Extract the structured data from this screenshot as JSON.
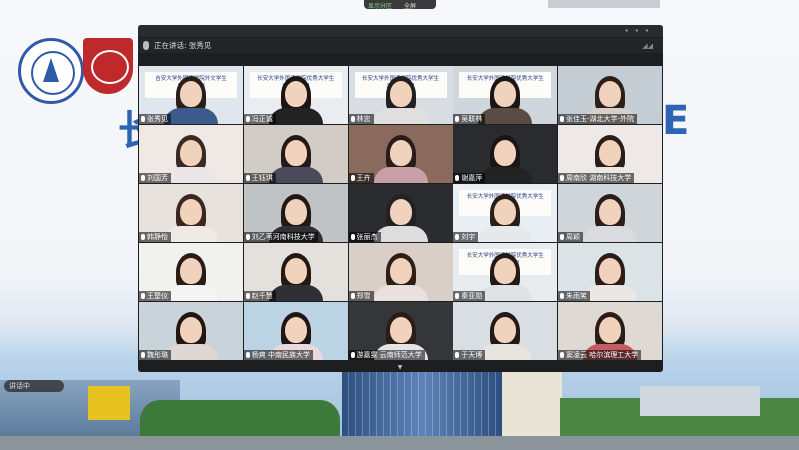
{
  "top_controls": {
    "left_label": "显示分区",
    "right_label": "全屏"
  },
  "window": {
    "speaker_label": "正在讲话: 张秀见"
  },
  "slide": {
    "title_left": "长",
    "title_right": "E"
  },
  "bottom_pill": {
    "label": "讲话中"
  },
  "participants": [
    {
      "name": "张秀见",
      "banner": "吉安大学外国语学院外文学生\n暑假实践团"
    },
    {
      "name": "冯正诚",
      "banner": "长安大学外国语学院优秀大学生\n暑假实践团"
    },
    {
      "name": "林忠",
      "banner": "长安大学外国语学院优秀大学生\n暑期实践团"
    },
    {
      "name": "吴联林",
      "banner": "长安大学外国语学院优秀大学生"
    },
    {
      "name": "张佳玉-湖北大学-外院",
      "banner": ""
    },
    {
      "name": "刘国芳",
      "banner": ""
    },
    {
      "name": "王钰琪",
      "banner": ""
    },
    {
      "name": "王卉",
      "banner": ""
    },
    {
      "name": "谢嘉萍",
      "banner": ""
    },
    {
      "name": "周南欣 湖南科技大学",
      "banner": ""
    },
    {
      "name": "韩静怡",
      "banner": ""
    },
    {
      "name": "刘乙苇河南科技大学",
      "banner": ""
    },
    {
      "name": "张丽杰",
      "banner": ""
    },
    {
      "name": "刘宇",
      "banner": "长安大学外国语学院优秀大学生"
    },
    {
      "name": "周颖",
      "banner": ""
    },
    {
      "name": "王楚仪",
      "banner": ""
    },
    {
      "name": "赵千慧",
      "banner": ""
    },
    {
      "name": "郑雪",
      "banner": ""
    },
    {
      "name": "秦亚勋",
      "banner": "长安大学外国语学院优秀大学生\n暑期实践团"
    },
    {
      "name": "朱雨笑",
      "banner": ""
    },
    {
      "name": "魏彤璐",
      "banner": ""
    },
    {
      "name": "杨爽 中南民族大学",
      "banner": ""
    },
    {
      "name": "游嘉雯 云南师范大学",
      "banner": ""
    },
    {
      "name": "于天博",
      "banner": ""
    },
    {
      "name": "窦凌云 哈尔滨理工大学",
      "banner": ""
    }
  ],
  "colors": {
    "accent": "#2d64b3",
    "window_bg": "#1d1e20",
    "brand_red": "#c0292b"
  }
}
